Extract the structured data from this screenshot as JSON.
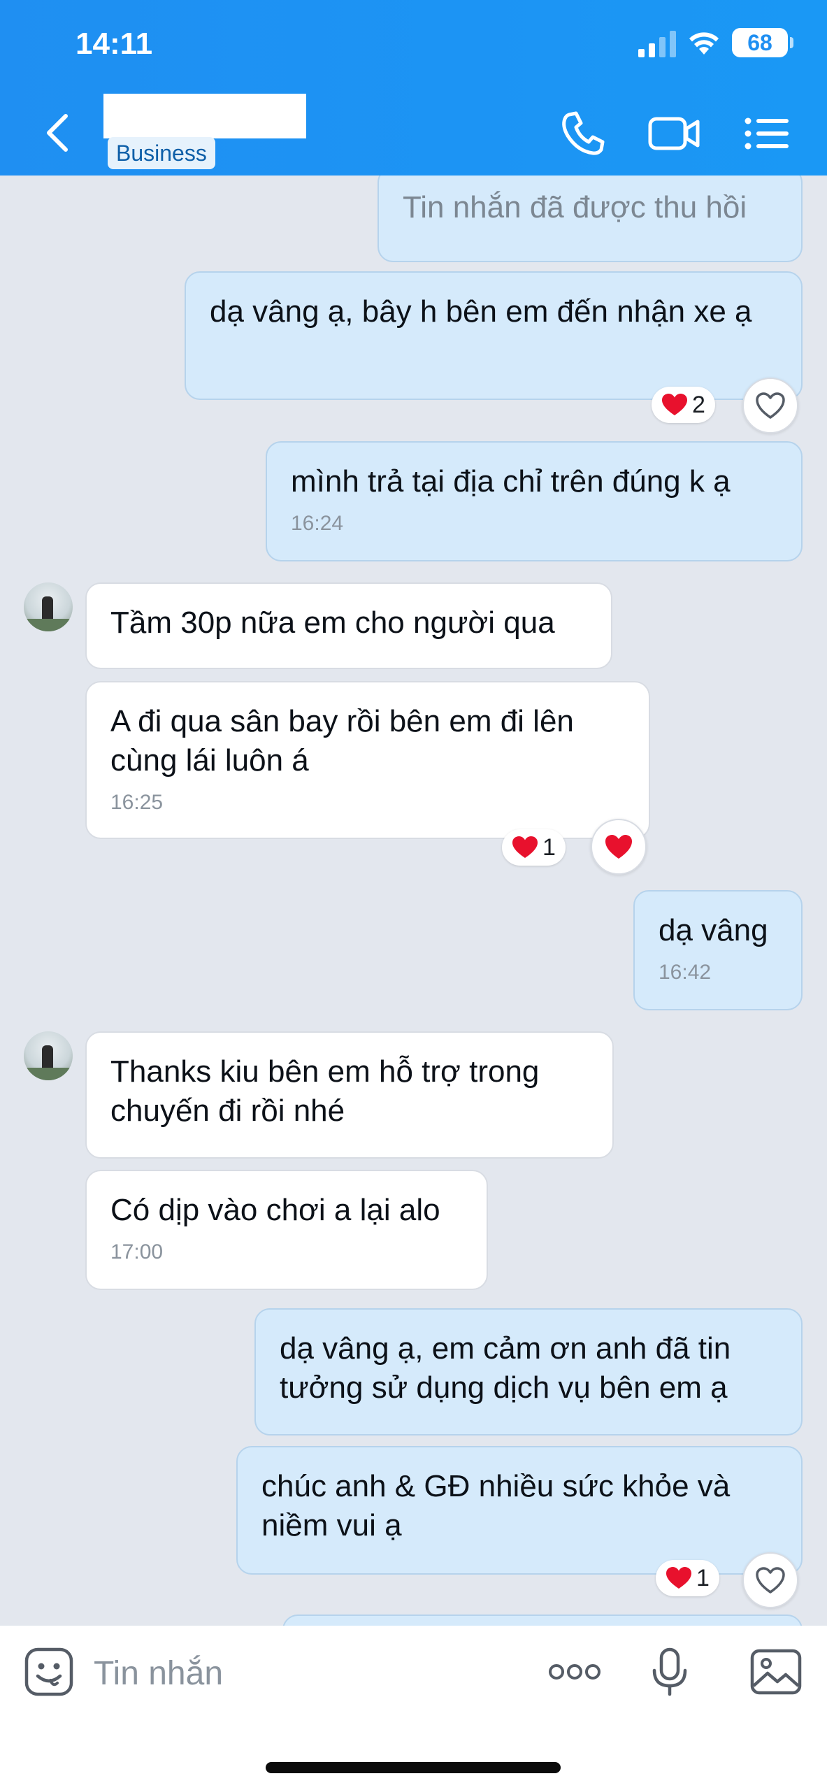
{
  "status_bar": {
    "time": "14:11",
    "battery": "68"
  },
  "header": {
    "badge": "Business",
    "icons": [
      "back-icon",
      "phone-icon",
      "video-call-icon",
      "menu-list-icon"
    ],
    "color": "#1f8ff2"
  },
  "messages": [
    {
      "side": "out",
      "text": "Tin nhắn đã được thu hồi",
      "recalled": true
    },
    {
      "side": "out",
      "text": "dạ vâng ạ, bây h bên em đến nhận xe ạ",
      "reaction": {
        "count": "2"
      }
    },
    {
      "side": "out",
      "text": "mình trả tại địa chỉ trên đúng k ạ",
      "time": "16:24"
    },
    {
      "side": "in",
      "text": "Tầm 30p nữa em cho người qua"
    },
    {
      "side": "in",
      "text": "A đi qua sân bay rồi bên em đi lên cùng lái luôn á",
      "time": "16:25",
      "reaction": {
        "count": "1"
      }
    },
    {
      "side": "out",
      "text": "dạ vâng",
      "time": "16:42"
    },
    {
      "side": "in",
      "text": "Thanks kiu bên em hỗ trợ trong chuyến đi rồi nhé"
    },
    {
      "side": "in",
      "text": "Có dịp vào chơi a lại alo",
      "time": "17:00"
    },
    {
      "side": "out",
      "text": "dạ vâng ạ, em cảm ơn anh đã tin tưởng sử dụng dịch vụ bên em ạ"
    },
    {
      "side": "out",
      "text": "chúc anh & GĐ nhiều sức khỏe và niềm vui ạ",
      "reaction": {
        "count": "1"
      }
    }
  ],
  "composer": {
    "placeholder": "Tin nhắn",
    "icons": [
      "sticker-icon",
      "more-icon",
      "microphone-icon",
      "image-icon"
    ]
  },
  "colors": {
    "outgoing_bubble": "#d5eafb",
    "incoming_bubble": "#ffffff",
    "chat_background": "#e3e7ee",
    "reaction_heart": "#e8112d"
  }
}
